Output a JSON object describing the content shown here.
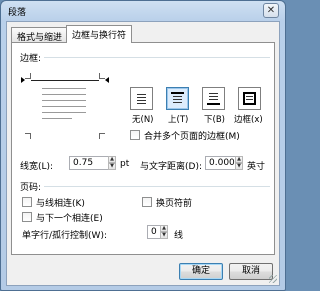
{
  "window": {
    "title": "段落",
    "close_glyph": "✕"
  },
  "tabs": [
    {
      "label": "格式与缩进",
      "active": false
    },
    {
      "label": "边框与换行符",
      "active": true
    }
  ],
  "border": {
    "section_label": "边框:",
    "options": [
      {
        "label": "无(N)",
        "icon": "border-none-icon",
        "selected": false
      },
      {
        "label": "上(T)",
        "icon": "border-top-icon",
        "selected": true
      },
      {
        "label": "下(B)",
        "icon": "border-bottom-icon",
        "selected": false
      },
      {
        "label": "边框(x)",
        "icon": "border-box-icon",
        "selected": false
      }
    ],
    "merge_checkbox_label": "合并多个页面的边框(M)",
    "merge_checked": false,
    "line_width_label": "线宽(L):",
    "line_width_value": "0.75",
    "line_width_unit": "pt",
    "distance_label": "与文字距离(D):",
    "distance_value": "0.000",
    "distance_unit": "英寸"
  },
  "pagination": {
    "section_label": "页码:",
    "keep_lines_label": "与线相连(K)",
    "keep_lines_checked": false,
    "page_break_label": "换页符前",
    "page_break_checked": false,
    "keep_next_label": "与下一个相连(E)",
    "keep_next_checked": false,
    "widow_label": "单字行/孤行控制(W):",
    "widow_value": "0",
    "widow_unit": "线"
  },
  "buttons": {
    "ok": "确定",
    "cancel": "取消"
  },
  "colors": {
    "accent": "#3c7fb1",
    "selected_bg": "#dcecfc"
  }
}
